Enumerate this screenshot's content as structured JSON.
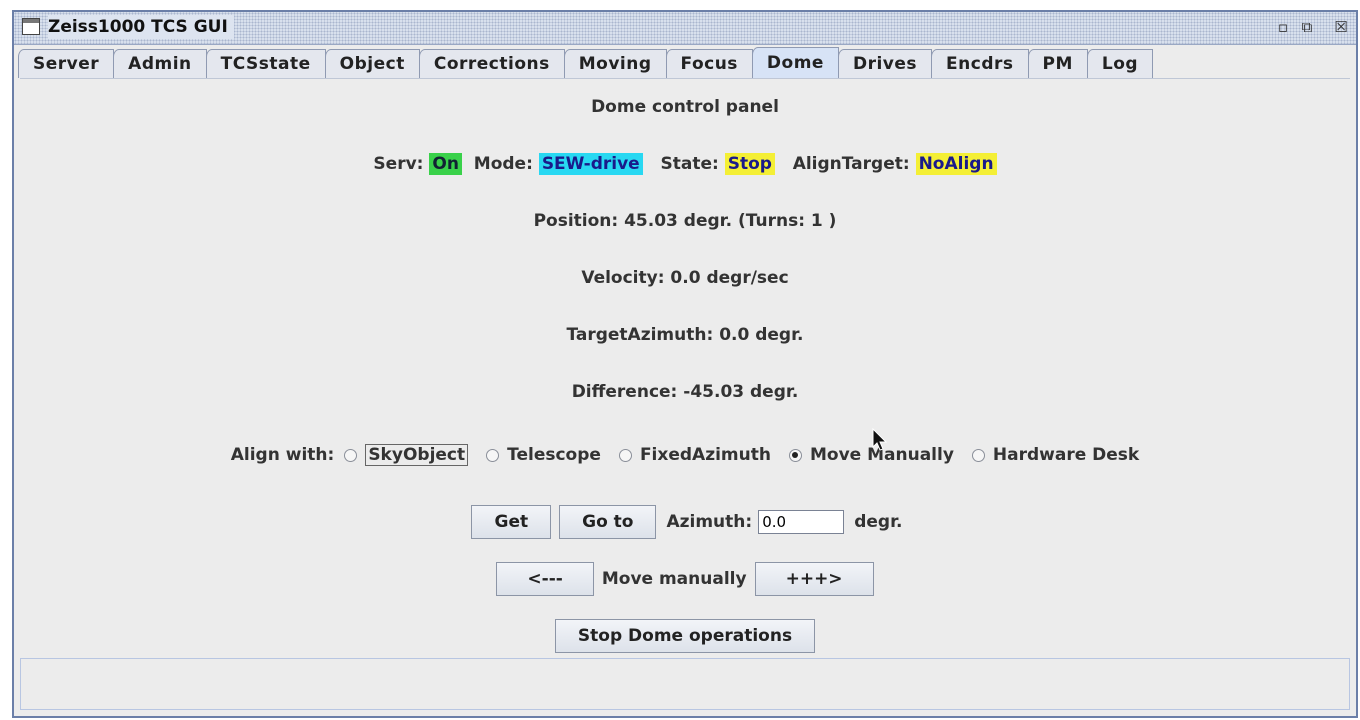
{
  "window": {
    "title": "Zeiss1000 TCS GUI"
  },
  "tabs": [
    {
      "label": "Server"
    },
    {
      "label": "Admin"
    },
    {
      "label": "TCSstate"
    },
    {
      "label": "Object"
    },
    {
      "label": "Corrections"
    },
    {
      "label": "Moving"
    },
    {
      "label": "Focus"
    },
    {
      "label": "Dome",
      "active": true
    },
    {
      "label": "Drives"
    },
    {
      "label": "Encdrs"
    },
    {
      "label": "PM"
    },
    {
      "label": "Log"
    }
  ],
  "panel": {
    "title": "Dome control panel",
    "status": {
      "serv_label": "Serv:",
      "serv_value": "On",
      "mode_label": "Mode:",
      "mode_value": "SEW-drive",
      "state_label": "State:",
      "state_value": "Stop",
      "align_label": "AlignTarget:",
      "align_value": "NoAlign"
    },
    "position": "Position: 45.03 degr.  (Turns: 1 )",
    "velocity": "Velocity: 0.0 degr/sec",
    "target_azimuth": "TargetAzimuth: 0.0 degr.",
    "difference": "Difference: -45.03 degr.",
    "align_with": {
      "label": "Align with:",
      "options": [
        "SkyObject",
        "Telescope",
        "FixedAzimuth",
        "Move Manually",
        "Hardware Desk"
      ],
      "selected": "Move Manually"
    },
    "get_button": "Get",
    "goto_button": "Go to",
    "azimuth_label": "Azimuth:",
    "azimuth_value": "0.0",
    "degr_label": "degr.",
    "left_button": "<---",
    "move_manually_label": "Move manually",
    "right_button": "+++>",
    "stop_button": "Stop Dome operations"
  },
  "colors": {
    "serv": "#39d14a",
    "mode": "#28d8f2",
    "state": "#f4ef35",
    "align": "#f4ef35"
  }
}
